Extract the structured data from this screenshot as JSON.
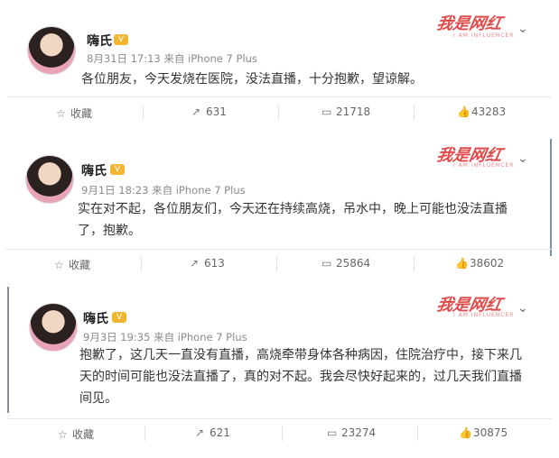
{
  "posts": [
    {
      "user": {
        "name": "嗨氏",
        "badge": "V"
      },
      "meta": "8月31日 17:13 来自 iPhone 7 Plus",
      "content_lines": [
        "各位朋友，今天发烧在医院，没法直播，十分抱歉，望谅解。"
      ],
      "actions": {
        "favorite": "收藏",
        "repost": "631",
        "comment": "21718",
        "like": "43283"
      },
      "watermark": {
        "title": "我是网红",
        "subtitle": "I AM INFLUENCER"
      }
    },
    {
      "user": {
        "name": "嗨氏",
        "badge": "V"
      },
      "meta": "9月1日 18:23 来自 iPhone 7 Plus",
      "content_lines": [
        "实在对不起，各位朋友们，今天还在持续高烧，吊水中，晚上可能也没法直播",
        "了，抱歉。"
      ],
      "actions": {
        "favorite": "收藏",
        "repost": "613",
        "comment": "25864",
        "like": "38602"
      },
      "watermark": {
        "title": "我是网红",
        "subtitle": "I AM INFLUENCER"
      }
    },
    {
      "user": {
        "name": "嗨氏",
        "badge": "V"
      },
      "meta": "9月3日 19:35 来自 iPhone 7 Plus",
      "content_lines": [
        "抱歉了，这几天一直没有直播，高烧牵带身体各种病因，住院治疗中，接下来几",
        "天的时间可能也没法直播了，真的对不起。我会尽快好起来的，过几天我们直播",
        "间见。"
      ],
      "actions": {
        "favorite": "收藏",
        "repost": "621",
        "comment": "23274",
        "like": "30875"
      },
      "watermark": {
        "title": "我是网红",
        "subtitle": "I AM INFLUENCER"
      }
    }
  ],
  "icons": {
    "favorite": "star-icon",
    "repost": "repost-icon",
    "comment": "comment-icon",
    "like": "thumb-up-icon",
    "menu": "chevron-down-icon"
  }
}
